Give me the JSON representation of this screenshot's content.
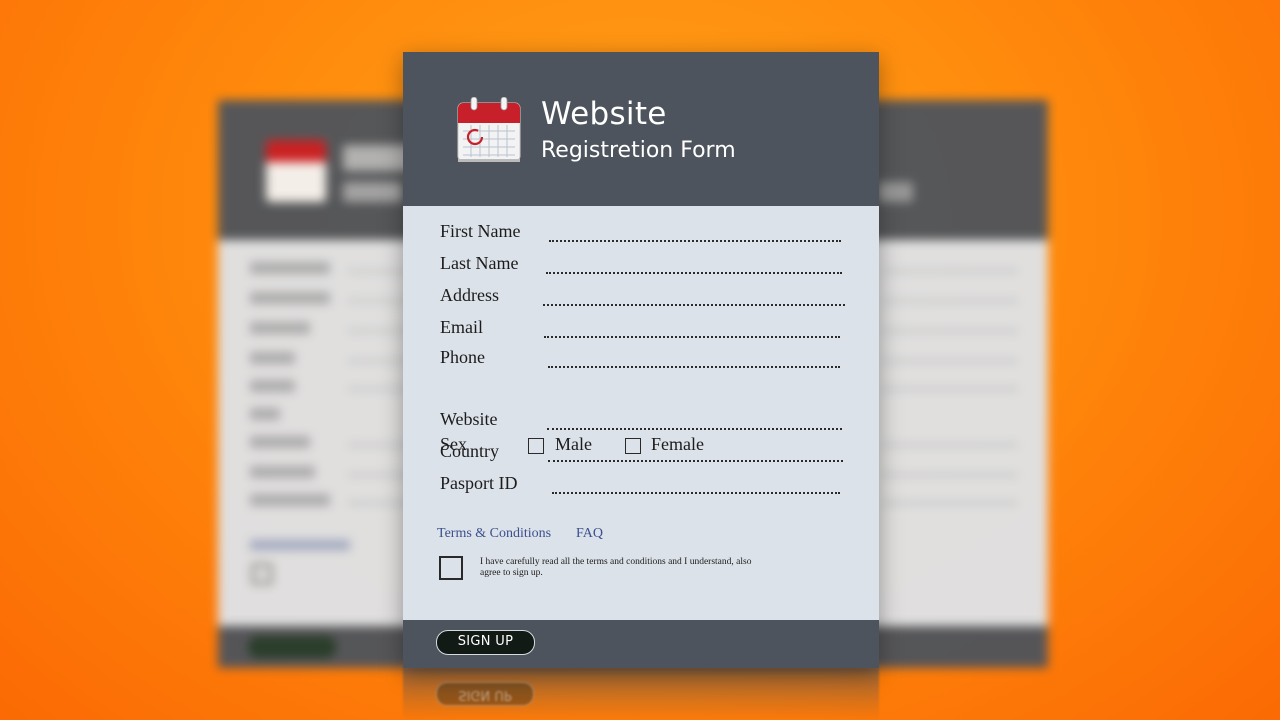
{
  "header": {
    "title": "Website",
    "subtitle": "Registretion Form",
    "icon": "calendar-icon"
  },
  "form": {
    "fields": [
      {
        "label": "First Name"
      },
      {
        "label": "Last Name"
      },
      {
        "label": "Address"
      },
      {
        "label": "Email"
      },
      {
        "label": "Phone"
      },
      {
        "label": "Website"
      },
      {
        "label": "Country"
      },
      {
        "label": "Pasport ID"
      }
    ],
    "sex": {
      "label": "Sex",
      "options": [
        "Male",
        "Female"
      ]
    }
  },
  "links": {
    "terms": "Terms & Conditions",
    "faq": "FAQ"
  },
  "agreement": {
    "text": "I have carefully read all the terms and conditions and I understand, also agree to sign up."
  },
  "footer": {
    "signup_label": "SIGN UP"
  },
  "colors": {
    "background": "#ff8a0c",
    "card": "#dce2e9",
    "header": "#4d545d",
    "link": "#3b4f8e",
    "button": "#111a15"
  }
}
